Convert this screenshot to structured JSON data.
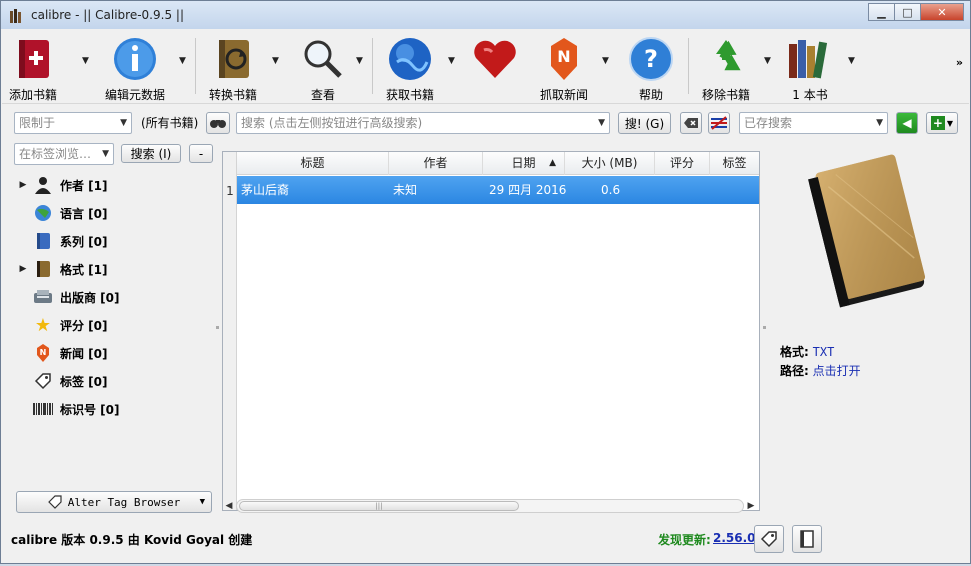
{
  "window": {
    "title": "calibre - || Calibre-0.9.5 ||"
  },
  "toolbar": {
    "items": [
      {
        "label": "添加书籍",
        "icon": "add-book-icon"
      },
      {
        "label": "编辑元数据",
        "icon": "info-icon"
      },
      {
        "label": "转换书籍",
        "icon": "convert-book-icon"
      },
      {
        "label": "查看",
        "icon": "magnifier-icon"
      },
      {
        "label": "获取书籍",
        "icon": "globe-icon"
      },
      {
        "label": "",
        "icon": "heart-icon"
      },
      {
        "label": "抓取新闻",
        "icon": "news-icon"
      },
      {
        "label": "帮助",
        "icon": "help-icon"
      },
      {
        "label": "移除书籍",
        "icon": "recycle-icon"
      },
      {
        "label": "1 本书",
        "icon": "library-books-icon"
      }
    ]
  },
  "search": {
    "restrict_placeholder": "限制于",
    "all_books": "(所有书籍)",
    "search_placeholder": "搜索 (点击左侧按钮进行高级搜索)",
    "search_button": "搜! (G)",
    "saved_placeholder": "已存搜索"
  },
  "tag_browser": {
    "filter_placeholder": "在标签浏览…",
    "find_button": "搜索 (I)",
    "collapse_button": "-",
    "items": [
      {
        "label": "作者 [1]",
        "icon": "person-icon",
        "expandable": true
      },
      {
        "label": "语言 [0]",
        "icon": "language-icon",
        "expandable": false
      },
      {
        "label": "系列 [0]",
        "icon": "series-icon",
        "expandable": false
      },
      {
        "label": "格式 [1]",
        "icon": "book-format-icon",
        "expandable": true
      },
      {
        "label": "出版商 [0]",
        "icon": "publisher-icon",
        "expandable": false
      },
      {
        "label": "评分 [0]",
        "icon": "star-icon",
        "expandable": false
      },
      {
        "label": "新闻 [0]",
        "icon": "news-small-icon",
        "expandable": false
      },
      {
        "label": "标签 [0]",
        "icon": "tag-icon",
        "expandable": false
      },
      {
        "label": "标识号 [0]",
        "icon": "barcode-icon",
        "expandable": false
      }
    ],
    "alter_button": "Alter Tag Browser"
  },
  "book_list": {
    "columns": [
      "标题",
      "作者",
      "日期",
      "大小 (MB)",
      "评分",
      "标签"
    ],
    "rows": [
      {
        "num": "1",
        "title": "茅山后裔",
        "author": "未知",
        "date": "29 四月 2016",
        "size": "0.6",
        "rating": "",
        "tags": ""
      }
    ]
  },
  "details": {
    "format_label": "格式:",
    "format_value": "TXT",
    "path_label": "路径:",
    "path_value": "点击打开"
  },
  "status": {
    "text": "calibre 版本 0.9.5 由 Kovid Goyal 创建",
    "update_label": "发现更新:",
    "update_version": "2.56.0"
  },
  "colors": {
    "selection": "#2b86e2",
    "link": "#1a2fb3",
    "update_green": "#1f8a1f"
  }
}
